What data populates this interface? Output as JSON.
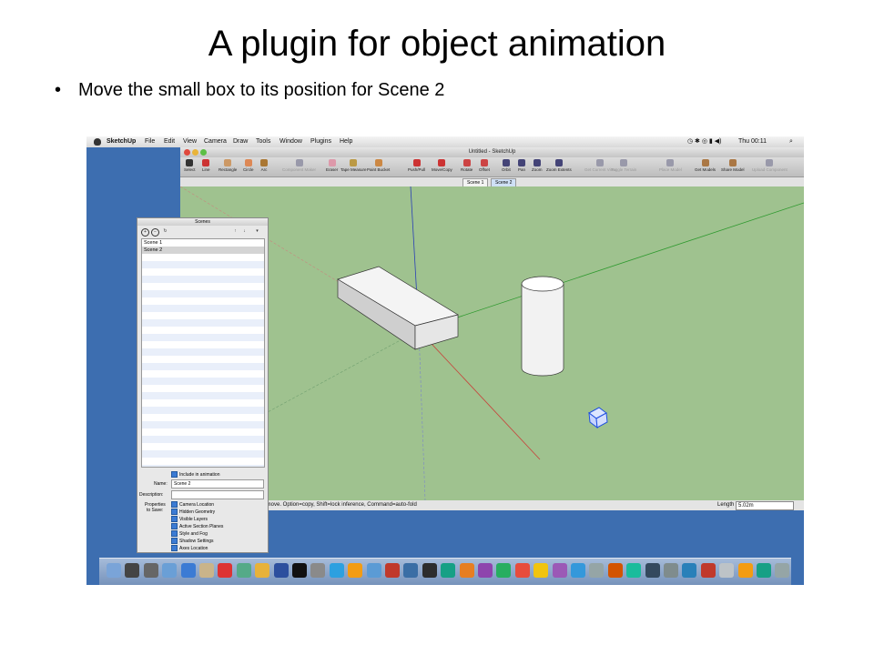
{
  "slide": {
    "title": "A plugin for object animation",
    "bullet": "Move the small box to its position for Scene 2"
  },
  "menubar": {
    "app_name": "SketchUp",
    "menus": [
      "File",
      "Edit",
      "View",
      "Camera",
      "Draw",
      "Tools",
      "Window",
      "Plugins",
      "Help"
    ],
    "clock": "Thu 00:11"
  },
  "window": {
    "title": "Untitled - SketchUp"
  },
  "toolbar": {
    "tools": [
      {
        "label": "Select",
        "enabled": true
      },
      {
        "label": "Line",
        "enabled": true
      },
      {
        "label": "Rectangle",
        "enabled": true
      },
      {
        "label": "Circle",
        "enabled": true
      },
      {
        "label": "Arc",
        "enabled": true
      },
      {
        "label": "Component Maker",
        "enabled": false
      },
      {
        "label": "Eraser",
        "enabled": true
      },
      {
        "label": "Tape Measure",
        "enabled": true
      },
      {
        "label": "Paint Bucket",
        "enabled": true
      },
      {
        "label": "Push/Pull",
        "enabled": true
      },
      {
        "label": "Move/Copy",
        "enabled": true
      },
      {
        "label": "Rotate",
        "enabled": true
      },
      {
        "label": "Offset",
        "enabled": true
      },
      {
        "label": "Orbit",
        "enabled": true
      },
      {
        "label": "Pan",
        "enabled": true
      },
      {
        "label": "Zoom",
        "enabled": true
      },
      {
        "label": "Zoom Extents",
        "enabled": true
      },
      {
        "label": "Get Current View",
        "enabled": false
      },
      {
        "label": "Toggle Terrain",
        "enabled": false
      },
      {
        "label": "Place Model",
        "enabled": false
      },
      {
        "label": "Get Models",
        "enabled": true
      },
      {
        "label": "Share Model",
        "enabled": true
      },
      {
        "label": "Upload Component",
        "enabled": false
      }
    ]
  },
  "scene_tabs": [
    {
      "label": "Scene 1",
      "active": false
    },
    {
      "label": "Scene 2",
      "active": true
    }
  ],
  "status": {
    "hint": "to move. Option=copy, Shift=lock inference, Command=auto-fold",
    "length_label": "Length",
    "length_value": "5.02m"
  },
  "scenes_panel": {
    "title": "Scenes",
    "scenes": [
      "Scene 1",
      "Scene 2"
    ],
    "selected_index": 1,
    "include_label": "Include in animation",
    "name_label": "Name:",
    "name_value": "Scene 2",
    "description_label": "Description:",
    "description_value": "",
    "properties_label": "Properties",
    "to_save_label": "to Save:",
    "properties": [
      "Camera Location",
      "Hidden Geometry",
      "Visible Layers",
      "Active Section Planes",
      "Style and Fog",
      "Shadow Settings",
      "Axes Location"
    ]
  },
  "colors": {
    "desktop": "#3d6eb0",
    "viewport": "#9fc28f",
    "axis_red": "#c8413a",
    "axis_green": "#2f9a2f",
    "axis_blue": "#2a3fb5",
    "selection_blue": "#1f4fe0"
  }
}
